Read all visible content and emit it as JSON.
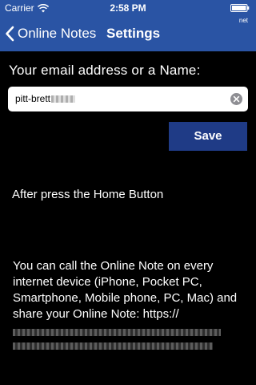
{
  "status_bar": {
    "carrier": "Carrier",
    "time": "2:58 PM",
    "battery_icon": "battery-full-icon",
    "wifi_icon": "wifi-icon"
  },
  "nav": {
    "back_label": "Online Notes",
    "title": "Settings",
    "badge": "net",
    "back_icon": "chevron-left-icon"
  },
  "form": {
    "email_label": "Your email address or a Name:",
    "email_value": "pitt-brett",
    "save_label": "Save",
    "clear_icon": "clear-circle-icon"
  },
  "info": {
    "after_text": "After press the Home Button",
    "body_text": "You can call the Online Note on every internet device (iPhone, Pocket PC, Smartphone, Mobile phone, PC, Mac) and share your Online Note: https://"
  },
  "colors": {
    "bar_blue": "#2a54a4",
    "button_blue": "#1f3b86",
    "background": "#000000",
    "text": "#ffffff"
  }
}
